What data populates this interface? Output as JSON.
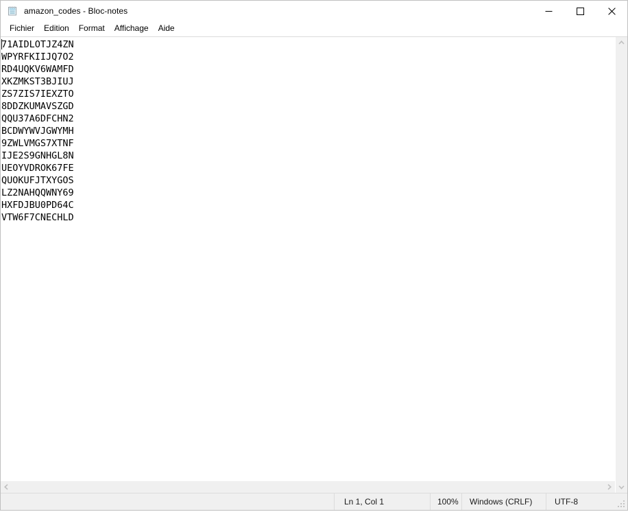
{
  "window": {
    "title": "amazon_codes - Bloc-notes",
    "icon": "notepad-icon"
  },
  "caption": {
    "minimize_label": "Réduire",
    "maximize_label": "Agrandir",
    "close_label": "Fermer",
    "minimize_icon": "minimize-icon",
    "maximize_icon": "maximize-icon",
    "close_icon": "close-icon"
  },
  "menubar": {
    "items": [
      {
        "label": "Fichier"
      },
      {
        "label": "Edition"
      },
      {
        "label": "Format"
      },
      {
        "label": "Affichage"
      },
      {
        "label": "Aide"
      }
    ]
  },
  "editor": {
    "lines": [
      "71AIDLOTJZ4ZN",
      "WPYRFKIIJQ7O2",
      "RD4UQKV6WAMFD",
      "XKZMKST3BJIUJ",
      "ZS7ZIS7IEXZTO",
      "8DDZKUMAVSZGD",
      "QQU37A6DFCHN2",
      "BCDWYWVJGWYMH",
      "9ZWLVMGS7XTNF",
      "IJE2S9GNHGL8N",
      "UEOYVDROK67FE",
      "QUOKUFJTXYGOS",
      "LZ2NAHQQWNY69",
      "HXFDJBU0PD64C",
      "VTW6F7CNECHLD"
    ]
  },
  "scrollbars": {
    "vertical_up_icon": "chevron-up-icon",
    "vertical_down_icon": "chevron-down-icon",
    "horizontal_left_icon": "chevron-left-icon",
    "horizontal_right_icon": "chevron-right-icon"
  },
  "statusbar": {
    "position": "Ln 1, Col 1",
    "zoom": "100%",
    "line_ending": "Windows (CRLF)",
    "encoding": "UTF-8",
    "grip_icon": "resize-grip-icon"
  },
  "colors": {
    "window_bg": "#ffffff",
    "chrome_bg": "#f0f0f0",
    "border": "#dcdcdc",
    "text": "#000000",
    "scroll_arrow": "#c0c0c0"
  }
}
